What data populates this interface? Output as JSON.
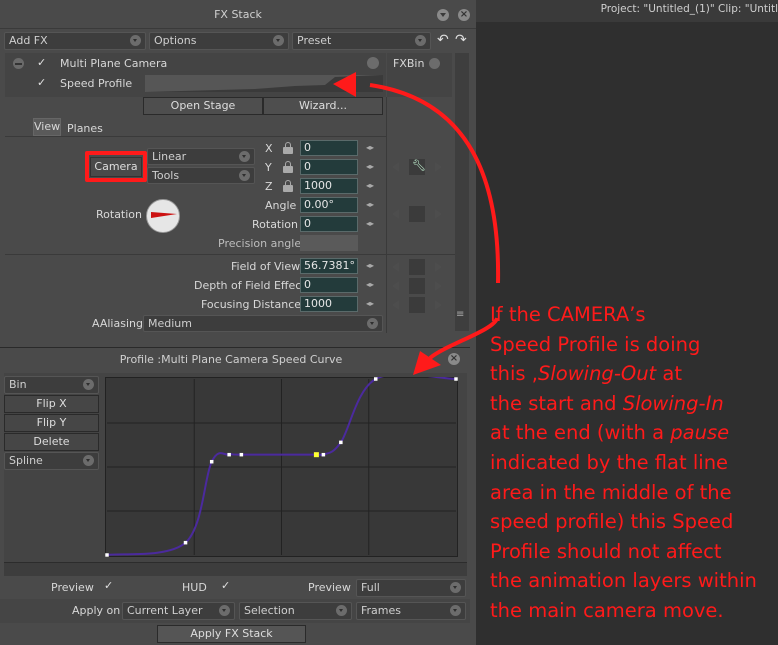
{
  "window": {
    "title": "FX Stack",
    "project_info": "Project:  \"Untitled_(1)\"  Clip: \"Untitl"
  },
  "toolbar": {
    "add_fx": "Add FX",
    "options": "Options",
    "preset": "Preset"
  },
  "fx_list": {
    "items": [
      {
        "label": "Multi Plane Camera",
        "checked": true
      },
      {
        "label": "Speed Profile",
        "checked": true
      }
    ],
    "fxbin": "FXBin"
  },
  "stage": {
    "open_stage": "Open Stage",
    "wizard": "Wizard..."
  },
  "tabs": {
    "view": "View",
    "planes": "Planes"
  },
  "camera": {
    "button": "Camera",
    "interp": "Linear",
    "tools": "Tools",
    "x_label": "X",
    "x_value": "0",
    "y_label": "Y",
    "y_value": "0",
    "z_label": "Z",
    "z_value": "1000",
    "angle_label": "Angle",
    "angle_value": "0.00°",
    "rotation_label": "Rotation",
    "rotation_value": "0",
    "rotation_dial_label": "Rotation",
    "precision_label": "Precision angle"
  },
  "lens": {
    "fov_label": "Field of View",
    "fov_value": "56.7381°",
    "dof_label": "Depth of Field Effect",
    "dof_value": "0",
    "focus_label": "Focusing Distance",
    "focus_value": "1000",
    "aaliasing_label": "AAliasing",
    "aaliasing_value": "Medium"
  },
  "profile": {
    "title": "Profile :Multi Plane Camera Speed Curve",
    "bin": "Bin",
    "flip_x": "Flip X",
    "flip_y": "Flip Y",
    "delete": "Delete",
    "spline": "Spline",
    "curve_color": "#4b2a9e",
    "points": [
      [
        0,
        0
      ],
      [
        0.225,
        0.07
      ],
      [
        0.3,
        0.53
      ],
      [
        0.35,
        0.57
      ],
      [
        0.385,
        0.57
      ],
      [
        0.6,
        0.57
      ],
      [
        0.62,
        0.57
      ],
      [
        0.67,
        0.64
      ],
      [
        0.77,
        1.0
      ],
      [
        1.0,
        1.0
      ]
    ],
    "selected_point": 5
  },
  "bottom": {
    "preview_label": "Preview",
    "hud_label": "HUD",
    "preview2_label": "Preview",
    "preview2_value": "Full",
    "apply_on_label": "Apply on",
    "apply_on_value": "Current Layer",
    "selection": "Selection",
    "frames": "Frames",
    "apply_button": "Apply FX Stack"
  },
  "annotation": {
    "color": "#ff1a1a",
    "lines": [
      [
        "If the CAMERA’s",
        ""
      ],
      [
        "Speed Profile is doing",
        ""
      ],
      [
        "this ,",
        "Slowing-Out",
        " at"
      ],
      [
        "the start and ",
        "Slowing-In",
        ""
      ],
      [
        "at the end (with a ",
        "pause",
        ""
      ],
      [
        "indicated by the flat line",
        ""
      ],
      [
        "area in the middle of the",
        ""
      ],
      [
        "speed profile) this Speed",
        ""
      ],
      [
        "Profile should not affect",
        ""
      ],
      [
        "the animation layers within",
        ""
      ],
      [
        "the main camera move.",
        ""
      ]
    ]
  }
}
